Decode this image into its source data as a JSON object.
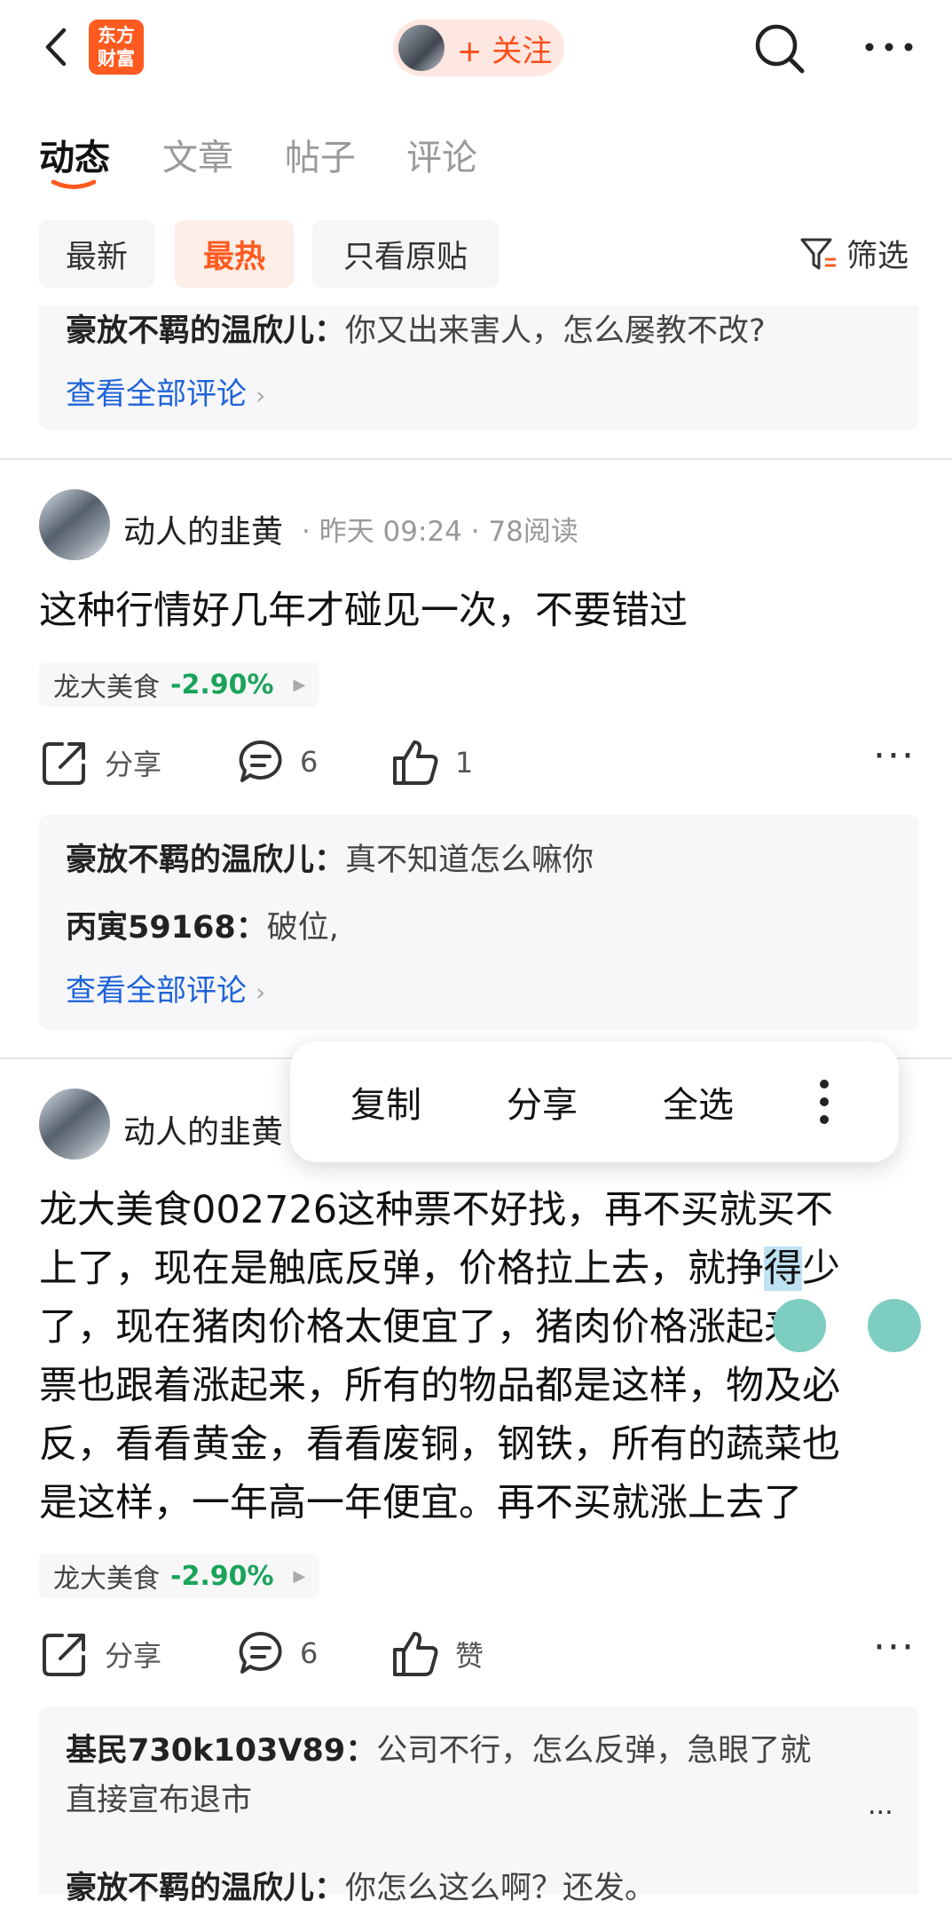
{
  "header": {
    "logo_line1": "东方",
    "logo_line2": "财富",
    "follow_label": "+ 关注"
  },
  "tabs": [
    "动态",
    "文章",
    "帖子",
    "评论"
  ],
  "filters": {
    "chips": [
      "最新",
      "最热",
      "只看原贴"
    ],
    "filter_label": "筛选"
  },
  "top_comment_box": {
    "comment": {
      "user": "豪放不羁的温欣儿：",
      "text": "你又出来害人，怎么屡教不改?"
    },
    "view_all": "查看全部评论"
  },
  "post1": {
    "author": "动人的韭黄",
    "meta": "· 昨天 09:24 · 78阅读",
    "text": "这种行情好几年才碰见一次，不要错过",
    "stock": {
      "name": "龙大美食",
      "change": "-2.90%"
    },
    "actions": {
      "share": "分享",
      "comments": "6",
      "likes": "1"
    },
    "comments": [
      {
        "user": "豪放不羁的温欣儿：",
        "text": "真不知道怎么嘛你"
      },
      {
        "user": "丙寅59168：",
        "text": "破位,"
      }
    ],
    "view_all": "查看全部评论"
  },
  "post2": {
    "author": "动人的韭黄",
    "text_lines": [
      "龙大美食002726这种票不好找，再不买就买不",
      "上了，现在是触底反弹，价格拉上去，就挣得少",
      "了，现在猪肉价格太便宜了，猪肉价格涨起来，",
      "票也跟着涨起来，所有的物品都是这样，物及必",
      "反，看看黄金，看看废铜，钢铁，所有的蔬菜也",
      "是这样，一年高一年便宜。再不买就涨上去了"
    ],
    "stock": {
      "name": "龙大美食",
      "change": "-2.90%"
    },
    "actions": {
      "share": "分享",
      "comments": "6",
      "likes": "赞"
    },
    "comments": [
      {
        "user": "基民730k103V89：",
        "text": "公司不行，怎么反弹，急眼了就",
        "text_cont": "直接宣布退市"
      },
      {
        "user": "豪放不羁的温欣儿：",
        "text": "你怎么这么啊？还发。"
      }
    ],
    "ellipsis": "..."
  },
  "context_menu": [
    "复制",
    "分享",
    "全选"
  ],
  "colors": {
    "accent": "#ff5a1f",
    "link": "#1e63d8",
    "down": "#1aa35a",
    "selection": "#bfe2f3",
    "handle": "#7dcdc0"
  }
}
